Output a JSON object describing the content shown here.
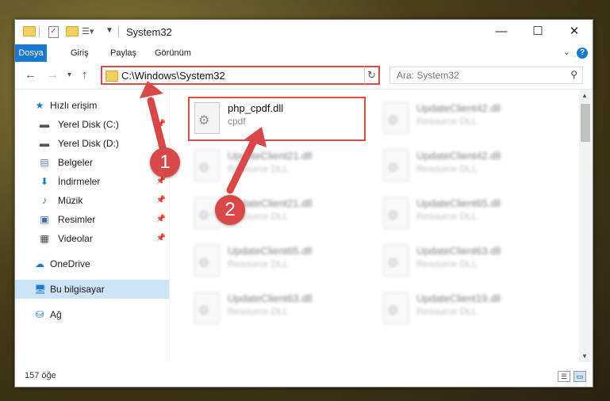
{
  "window": {
    "title": "System32"
  },
  "ribbon": {
    "tabs": [
      "Dosya",
      "Giriş",
      "Paylaş",
      "Görünüm"
    ],
    "help": "?"
  },
  "nav": {
    "address": "C:\\Windows\\System32",
    "search_placeholder": "Ara: System32"
  },
  "sidebar": {
    "items": [
      {
        "label": "Hızlı erişim",
        "icon": "star-icon"
      },
      {
        "label": "Yerel Disk (C:)",
        "icon": "drive-icon",
        "pinned": true
      },
      {
        "label": "Yerel Disk (D:)",
        "icon": "drive-icon",
        "pinned": true
      },
      {
        "label": "Belgeler",
        "icon": "documents-icon",
        "pinned": true
      },
      {
        "label": "İndirmeler",
        "icon": "download-icon",
        "pinned": true
      },
      {
        "label": "Müzik",
        "icon": "music-icon",
        "pinned": true
      },
      {
        "label": "Resimler",
        "icon": "pictures-icon",
        "pinned": true
      },
      {
        "label": "Videolar",
        "icon": "video-icon",
        "pinned": true
      },
      {
        "label": "OneDrive",
        "icon": "cloud-icon"
      },
      {
        "label": "Bu bilgisayar",
        "icon": "computer-icon",
        "selected": true
      },
      {
        "label": "Ağ",
        "icon": "network-icon"
      }
    ]
  },
  "files": {
    "highlighted": {
      "name": "php_cpdf.dll",
      "type": "cpdf"
    },
    "left_column": [
      {
        "name": "UpdateClient21.dll",
        "type": "Resource DLL"
      },
      {
        "name": "UpdateClient21.dll",
        "type": "Resource DLL"
      },
      {
        "name": "UpdateClient65.dll",
        "type": "Resource DLL"
      },
      {
        "name": "UpdateClient63.dll",
        "type": "Resource DLL"
      }
    ],
    "right_column": [
      {
        "name": "UpdateClient42.dll",
        "type": "Resource DLL"
      },
      {
        "name": "UpdateClient42.dll",
        "type": "Resource DLL"
      },
      {
        "name": "UpdateClient65.dll",
        "type": "Resource DLL"
      },
      {
        "name": "UpdateClient63.dll",
        "type": "Resource DLL"
      },
      {
        "name": "UpdateClient19.dll",
        "type": "Resource DLL"
      }
    ]
  },
  "status": {
    "item_count": "157 öğe"
  },
  "annotations": {
    "marker1": "1",
    "marker2": "2"
  },
  "colors": {
    "accent": "#1979ca",
    "annotation_red": "#d94848"
  }
}
